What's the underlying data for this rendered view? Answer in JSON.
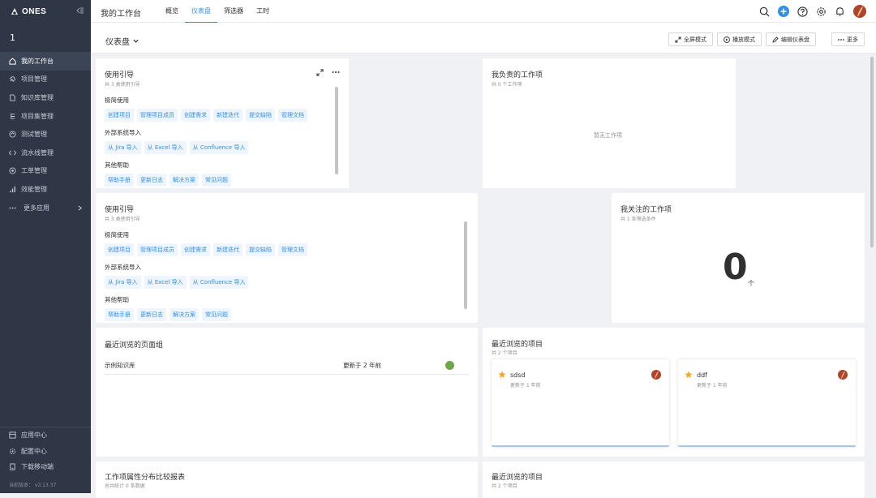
{
  "app": {
    "logo": "ONES",
    "workspace": "1"
  },
  "sidebar": {
    "items": [
      {
        "label": "我的工作台",
        "icon": "home-icon",
        "active": true
      },
      {
        "label": "项目管理",
        "icon": "rocket-icon"
      },
      {
        "label": "知识库管理",
        "icon": "document-icon"
      },
      {
        "label": "项目集管理",
        "icon": "hierarchy-icon"
      },
      {
        "label": "测试管理",
        "icon": "test-icon"
      },
      {
        "label": "流水线管理",
        "icon": "code-icon"
      },
      {
        "label": "工单管理",
        "icon": "target-icon"
      },
      {
        "label": "效能管理",
        "icon": "bar-chart-icon"
      },
      {
        "label": "更多应用",
        "icon": "dots-icon"
      }
    ],
    "bottom": [
      {
        "label": "应用中心",
        "icon": "app-center-icon"
      },
      {
        "label": "配置中心",
        "icon": "settings-icon"
      },
      {
        "label": "下载移动端",
        "icon": "mobile-icon"
      }
    ],
    "version": "当前版本： v3.13.37"
  },
  "topbar": {
    "title": "我的工作台",
    "tabs": [
      "概览",
      "仪表盘",
      "筛选器",
      "工时"
    ],
    "active_tab": 1
  },
  "subbar": {
    "title": "仪表盘",
    "buttons": {
      "fullscreen": "全屏模式",
      "play": "播放模式",
      "edit": "编辑仪表盘",
      "more": "更多"
    }
  },
  "guide": {
    "title": "使用引导",
    "subtitle": "共 3 类使用引导",
    "sections": [
      {
        "name": "极简使用",
        "tags": [
          "创建项目",
          "管理项目成员",
          "创建需求",
          "新建迭代",
          "提交缺陷",
          "管理文档"
        ]
      },
      {
        "name": "外部系统导入",
        "tags": [
          "从 Jira 导入",
          "从 Excel 导入",
          "从 Confluence 导入"
        ]
      },
      {
        "name": "其他帮助",
        "tags": [
          "帮助手册",
          "更新日志",
          "解决方案",
          "常见问题"
        ]
      }
    ]
  },
  "my_items": {
    "title": "我负责的工作项",
    "subtitle": "共 0 个工作项",
    "empty": "暂无工作项"
  },
  "followed": {
    "title": "我关注的工作项",
    "subtitle": "共 1 条筛选条件",
    "count": "0",
    "unit": "个"
  },
  "recent_pages": {
    "title": "最近浏览的页面组",
    "rows": [
      {
        "name": "示例知识库",
        "updated": "更新于 2 年前"
      }
    ]
  },
  "recent_projects": {
    "title": "最近浏览的项目",
    "subtitle": "共 2 个项目",
    "projects": [
      {
        "name": "sdsd",
        "updated": "更新于 1 年前"
      },
      {
        "name": "ddf",
        "updated": "更新于 1 年前"
      }
    ]
  },
  "report": {
    "title": "工作项属性分布比较报表",
    "subtitle": "总共统计 0 条数据"
  },
  "recent_projects_2": {
    "title": "最近浏览的项目",
    "subtitle": "共 2 个项目"
  },
  "colors": {
    "sidebar": "#2f3746",
    "accent": "#338fe5",
    "avatar": "#b0442a",
    "star": "#f5a623",
    "kb_dot": "#6fa64a"
  }
}
